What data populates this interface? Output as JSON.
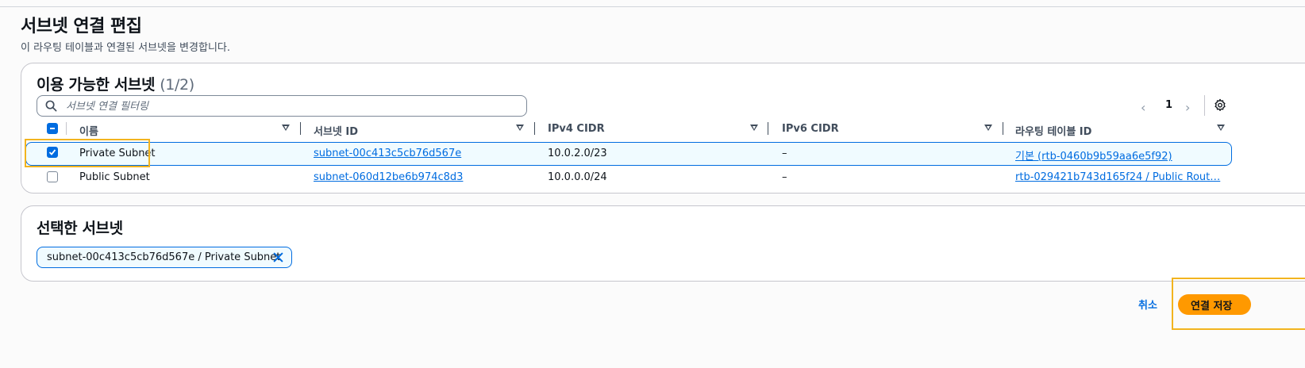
{
  "page": {
    "title": "서브넷 연결 편집",
    "description": "이 라우팅 테이블과 연결된 서브넷을 변경합니다."
  },
  "available": {
    "title": "이용 가능한 서브넷",
    "count": "(1/2)",
    "filter_placeholder": "서브넷 연결 필터링",
    "page_number": "1",
    "columns": [
      "이름",
      "서브넷 ID",
      "IPv4 CIDR",
      "IPv6 CIDR",
      "라우팅 테이블 ID"
    ],
    "rows": [
      {
        "name": "Private Subnet",
        "subnet_id": "subnet-00c413c5cb76d567e",
        "ipv4": "10.0.2.0/23",
        "ipv6": "–",
        "route_table": "기본 (rtb-0460b9b59aa6e5f92)",
        "checked": true
      },
      {
        "name": "Public Subnet",
        "subnet_id": "subnet-060d12be6b974c8d3",
        "ipv4": "10.0.0.0/24",
        "ipv6": "–",
        "route_table": "rtb-029421b743d165f24 / Public Rout…",
        "checked": false
      }
    ]
  },
  "selected": {
    "title": "선택한 서브넷",
    "token": "subnet-00c413c5cb76d567e / Private Subnet"
  },
  "actions": {
    "cancel": "취소",
    "save": "연결 저장"
  },
  "colors": {
    "accent": "#006ce0",
    "primary_button": "#ff9900",
    "highlight": "#f2b41f"
  }
}
